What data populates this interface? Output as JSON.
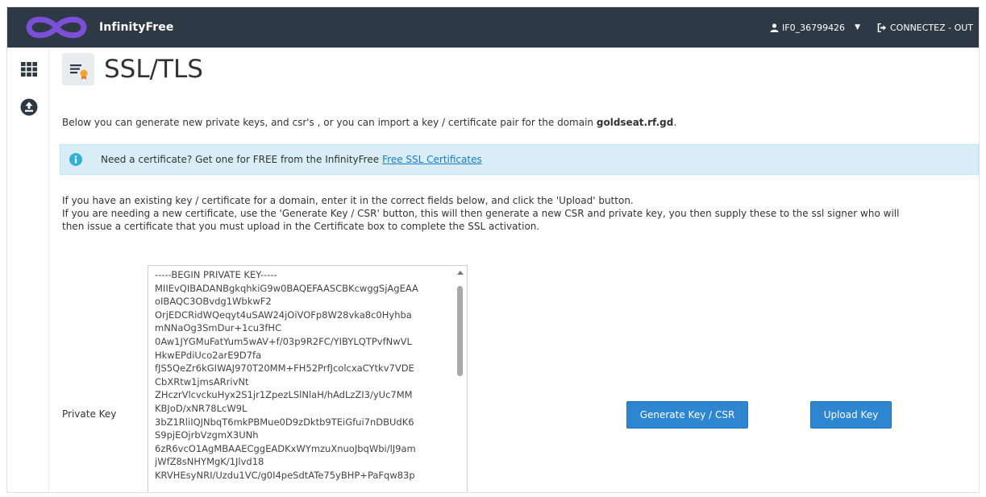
{
  "header": {
    "brand_name": "InfinityFree",
    "username": "IF0_36799426",
    "logout_label": "CONNECTEZ - OUT"
  },
  "sidebar": {
    "icons": [
      "grid-icon",
      "upload-icon"
    ]
  },
  "page": {
    "title": "SSL/TLS",
    "intro_text": "Below you can generate new private keys, and csr's , or you can import a key / certificate pair for the domain",
    "domain": "goldseat.rf.gd",
    "intro_end": ".",
    "alert_text": "Need a certificate? Get one for FREE from the InfinityFree",
    "alert_link": "Free SSL Certificates",
    "help_line1": "If you have an existing key / certificate for a domain, enter it in the correct fields below, and click the 'Upload' button.",
    "help_line2": "If you are needing a new certificate, use the 'Generate Key / CSR' button, this will then generate a new CSR and private key, you then supply these to the ssl signer who will",
    "help_line3": "then issue a certificate that you must upload in the Certificate box to complete the SSL activation.",
    "private_key_label": "Private Key",
    "private_key_lines": [
      "-----BEGIN PRIVATE KEY-----",
      "MIIEvQIBADANBgkqhkiG9w0BAQEFAASCBKcwggSjAgEAA",
      "oIBAQC3OBvdg1WbkwF2",
      "OrjEDCRidWQeqyt4uSAW24jOiVOFp8W28vka8c0Hyhba",
      "mNNaOg3SmDur+1cu3fHC",
      "0Aw1JYGMuFatYum5wAV+f/03p9R2FC/YIBYLQTPvfNwVL",
      "HkwEPdiUco2arE9D7fa",
      "fJS5QeZr6kGIWAJ970T20MM+FH52PrfJcolcxaCYtkv7VDE",
      "CbXRtw1jmsARrivNt",
      "ZHczrVlcvckuHyx2S1jr1ZpezLSlNlaH/hAdLzZI3/yUc7MM",
      "KBJoD/xNR78LcW9L",
      "3bZ1RliIQJNbqT6mkPBMue0D9zDktb9TEiGfui7nDBUdK6",
      "S9pjEOjrbVzgmX3UNh",
      "6zR6vcO1AgMBAAECggEADKxWYmzuXnuoJbqWbi/lJ9am",
      "jWfZ8sNHYMgK/1Jlvd18",
      "KRVHEsyNRI/Uzdu1VC/g0I4peSdtATe75yBHP+PaFqw83p"
    ],
    "generate_button": "Generate Key / CSR",
    "upload_button": "Upload Key"
  },
  "colors": {
    "header_bg": "#2d3a45",
    "brand_logo": "#7b4fd6",
    "alert_bg": "#d9edf7",
    "alert_icon_bg": "#31b0d5",
    "link": "#1a7bc6",
    "button": "#2e86d1"
  }
}
